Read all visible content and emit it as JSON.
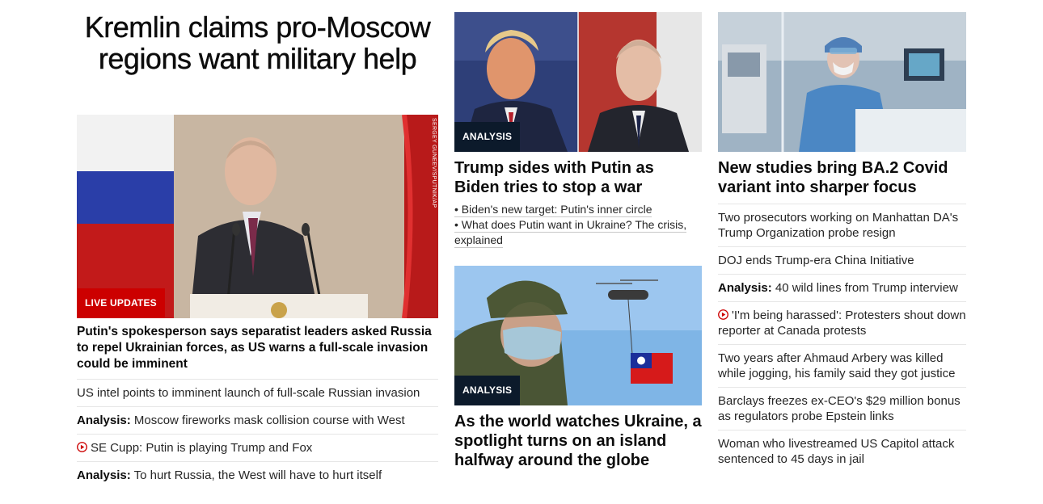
{
  "left": {
    "headline": "Kremlin claims pro-Moscow regions want military help",
    "badge": "LIVE UPDATES",
    "photo_credit": "SERGEY GUNEEV/SPUTNIK/AP",
    "lead_title": "Putin's spokesperson says separatist leaders asked Russia to repel Ukrainian forces, as US warns a full-scale invasion could be imminent",
    "items": [
      {
        "prefix": "",
        "text": "US intel points to imminent launch of full-scale Russian invasion",
        "icon": ""
      },
      {
        "prefix": "Analysis:",
        "text": " Moscow fireworks mask collision course with West",
        "icon": ""
      },
      {
        "prefix": "",
        "text": "SE Cupp: Putin is playing Trump and Fox",
        "icon": "play-icon"
      },
      {
        "prefix": "Analysis:",
        "text": " To hurt Russia, the West will have to hurt itself",
        "icon": ""
      }
    ]
  },
  "middle": {
    "card1": {
      "badge": "ANALYSIS",
      "title": "Trump sides with Putin as Biden tries to stop a war",
      "links": [
        "• Biden's new target: Putin's inner circle",
        "• What does Putin want in Ukraine? The crisis, explained"
      ]
    },
    "card2": {
      "badge": "ANALYSIS",
      "title": "As the world watches Ukraine, a spotlight turns on an island halfway around the globe"
    }
  },
  "right": {
    "title": "New studies bring BA.2 Covid variant into sharper focus",
    "items": [
      {
        "prefix": "",
        "text": "Two prosecutors working on Manhattan DA's Trump Organization probe resign",
        "icon": ""
      },
      {
        "prefix": "",
        "text": "DOJ ends Trump-era China Initiative",
        "icon": ""
      },
      {
        "prefix": "Analysis:",
        "text": " 40 wild lines from Trump interview",
        "icon": ""
      },
      {
        "prefix": "",
        "text": "'I'm being harassed': Protesters shout down reporter at Canada protests",
        "icon": "play-icon"
      },
      {
        "prefix": "",
        "text": "Two years after Ahmaud Arbery was killed while jogging, his family said they got justice",
        "icon": ""
      },
      {
        "prefix": "",
        "text": "Barclays freezes ex-CEO's $29 million bonus as regulators probe Epstein links",
        "icon": ""
      },
      {
        "prefix": "",
        "text": "Woman who livestreamed US Capitol attack sentenced to 45 days in jail",
        "icon": ""
      }
    ]
  },
  "colors": {
    "badge_red": "#cc0000",
    "badge_dark": "#0c1a2b",
    "play_icon": "#cc0000"
  }
}
